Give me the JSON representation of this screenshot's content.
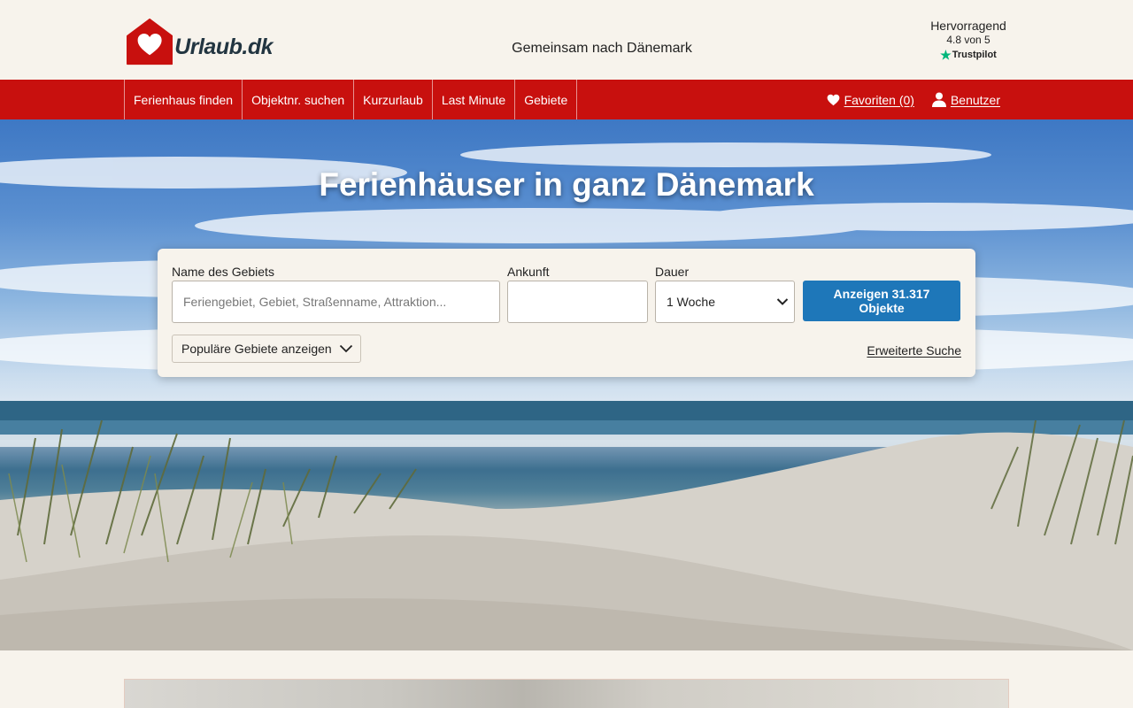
{
  "header": {
    "logo_text": "Urlaub.dk",
    "tagline": "Gemeinsam nach Dänemark",
    "trustpilot": {
      "title": "Hervorragend",
      "score": "4.8 von 5",
      "brand": "Trustpilot"
    }
  },
  "nav": {
    "items": [
      {
        "label": "Ferienhaus finden"
      },
      {
        "label": "Objektnr. suchen"
      },
      {
        "label": "Kurzurlaub"
      },
      {
        "label": "Last Minute"
      },
      {
        "label": "Gebiete"
      }
    ],
    "favorites_label": "Favoriten (0)",
    "user_label": "Benutzer"
  },
  "hero": {
    "title": "Ferienhäuser in ganz Dänemark"
  },
  "search": {
    "area_label": "Name des Gebiets",
    "area_placeholder": "Feriengebiet, Gebiet, Straßenname, Attraktion...",
    "arrival_label": "Ankunft",
    "arrival_value": "",
    "duration_label": "Dauer",
    "duration_value": "1 Woche",
    "submit_label": "Anzeigen 31.317 Objekte",
    "popular_label": "Populäre Gebiete anzeigen",
    "advanced_label": "Erweiterte Suche"
  },
  "colors": {
    "brand_red": "#c8100e",
    "button_blue": "#1e77b9",
    "background": "#f7f3ec",
    "trustpilot_green": "#00b67a"
  },
  "icons": [
    "heart-icon",
    "user-icon",
    "calendar-icon",
    "chevron-down-icon",
    "trustpilot-star-icon"
  ]
}
